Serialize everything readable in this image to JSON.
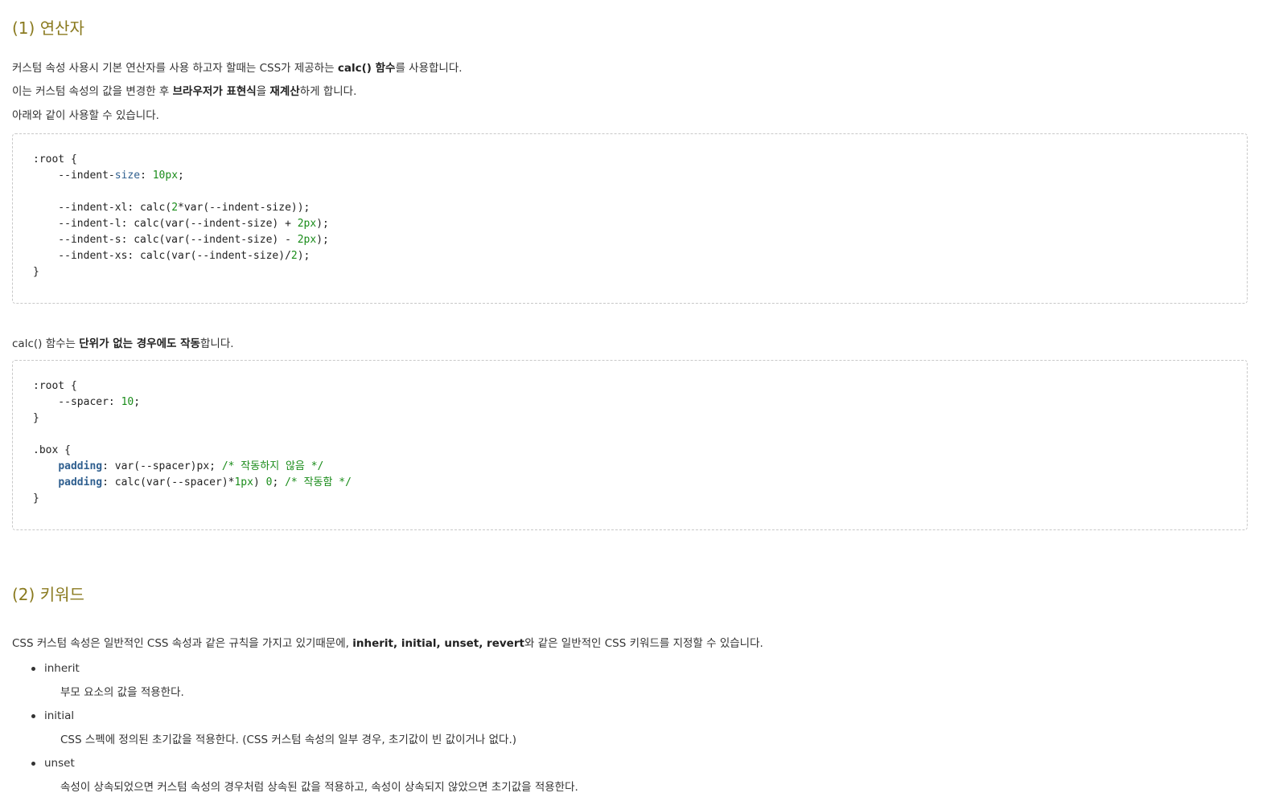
{
  "section1": {
    "heading": "(1) 연산자",
    "line1_a": "커스텀 속성 사용시 기본 연산자를 사용 하고자 할때는 CSS가 제공하는 ",
    "line1_b": "calc() 함수",
    "line1_c": "를 사용합니다.",
    "line2_a": "이는 커스텀 속성의 값을 변경한 후 ",
    "line2_b": "브라우저가 표현식",
    "line2_c": "을 ",
    "line2_d": "재계산",
    "line2_e": "하게 합니다.",
    "line3": "아래와 같이 사용할 수 있습니다.",
    "note_a": "calc() 함수는 ",
    "note_b": "단위가 없는 경우에도 작동",
    "note_c": "합니다."
  },
  "code1": {
    "l1": ":root {",
    "l2_a": "    --indent-",
    "l2_b": "size",
    "l2_c": ": ",
    "l2_d": "10px",
    "l2_e": ";",
    "l4_a": "    --indent-xl: calc(",
    "l4_b": "2",
    "l4_c": "*var(--indent-size));",
    "l5_a": "    --indent-l: calc(var(--indent-size) + ",
    "l5_b": "2px",
    "l5_c": ");",
    "l6_a": "    --indent-s: calc(var(--indent-size) - ",
    "l6_b": "2px",
    "l6_c": ");",
    "l7_a": "    --indent-xs: calc(var(--indent-size)/",
    "l7_b": "2",
    "l7_c": ");",
    "l8": "}"
  },
  "code2": {
    "l1": ":root {",
    "l2_a": "    --spacer: ",
    "l2_b": "10",
    "l2_c": ";",
    "l3": "}",
    "l5": ".box {",
    "l6_a": "    ",
    "l6_b": "padding",
    "l6_c": ": var(--spacer)px; ",
    "l6_d": "/* 작동하지 않음 */",
    "l7_a": "    ",
    "l7_b": "padding",
    "l7_c": ": calc(var(--spacer)*",
    "l7_d": "1px",
    "l7_e": ") ",
    "l7_f": "0",
    "l7_g": "; ",
    "l7_h": "/* 작동함 */",
    "l8": "}"
  },
  "section2": {
    "heading": "(2) 키워드",
    "intro_a": "CSS 커스텀 속성은 일반적인 CSS 속성과 같은 규칙을 가지고 있기때문에, ",
    "intro_b": "inherit, initial, unset, revert",
    "intro_c": "와 같은 일반적인 CSS 키워드를 지정할 수 있습니다.",
    "items": [
      {
        "term": "inherit",
        "desc": "부모 요소의 값을 적용한다."
      },
      {
        "term": "initial",
        "desc": "CSS 스펙에 정의된 초기값을 적용한다. (CSS 커스텀 속성의 일부 경우, 초기값이 빈 값이거나 없다.)"
      },
      {
        "term": "unset",
        "desc": "속성이 상속되었으면 커스텀 속성의 경우처럼 상속된 값을 적용하고, 속성이 상속되지 않았으면 초기값을 적용한다."
      }
    ]
  },
  "colors": {
    "heading": "#8a7a1f",
    "number": "#1a8c1a",
    "keyword": "#2f5f8f",
    "comment": "#1a8c1a"
  }
}
